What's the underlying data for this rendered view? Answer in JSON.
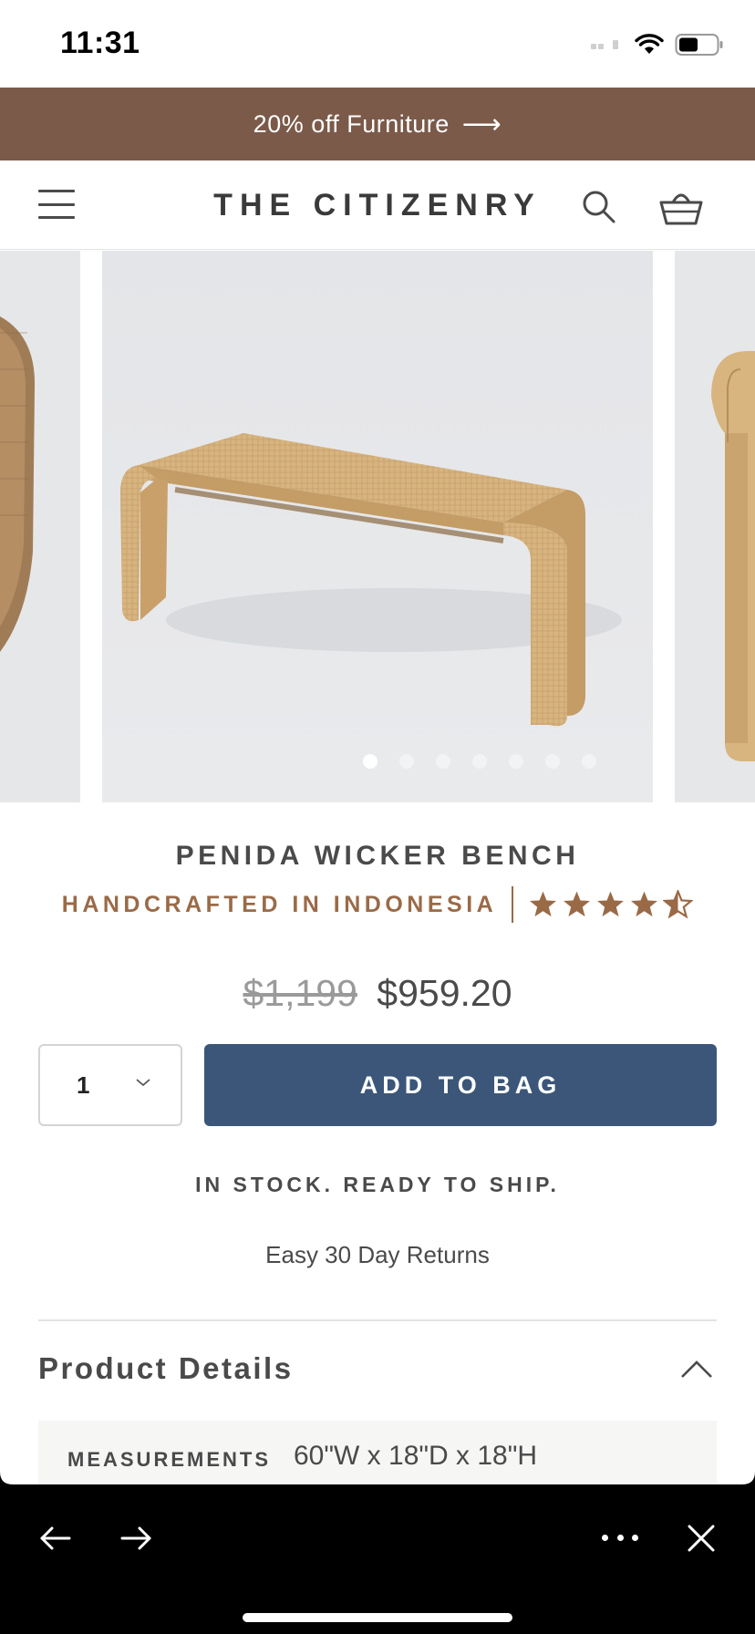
{
  "status_bar": {
    "time": "11:31"
  },
  "promo": {
    "text": "20% off Furniture",
    "arrow": "⟶"
  },
  "header": {
    "logo": "THE CITIZENRY",
    "icons": [
      "menu-icon",
      "search-icon",
      "cart-icon"
    ]
  },
  "gallery": {
    "image_count": 7,
    "active_index": 0,
    "subject": "wicker bench"
  },
  "product": {
    "name": "PENIDA WICKER BENCH",
    "origin": "HANDCRAFTED IN INDONESIA",
    "rating": 4.5,
    "rating_max": 5,
    "price_original": "$1,199",
    "price_sale": "$959.20",
    "quantity": "1",
    "add_to_bag": "ADD TO BAG",
    "stock_status": "IN STOCK. READY TO SHIP.",
    "returns": "Easy 30 Day Returns"
  },
  "details": {
    "title": "Product Details",
    "measurements_label": "MEASUREMENTS",
    "measurements_value": "60\"W x 18\"D x 18\"H"
  },
  "colors": {
    "promo_bg": "#7b5a4a",
    "accent_brown": "#9a6a47",
    "button_blue": "#3b5678"
  }
}
